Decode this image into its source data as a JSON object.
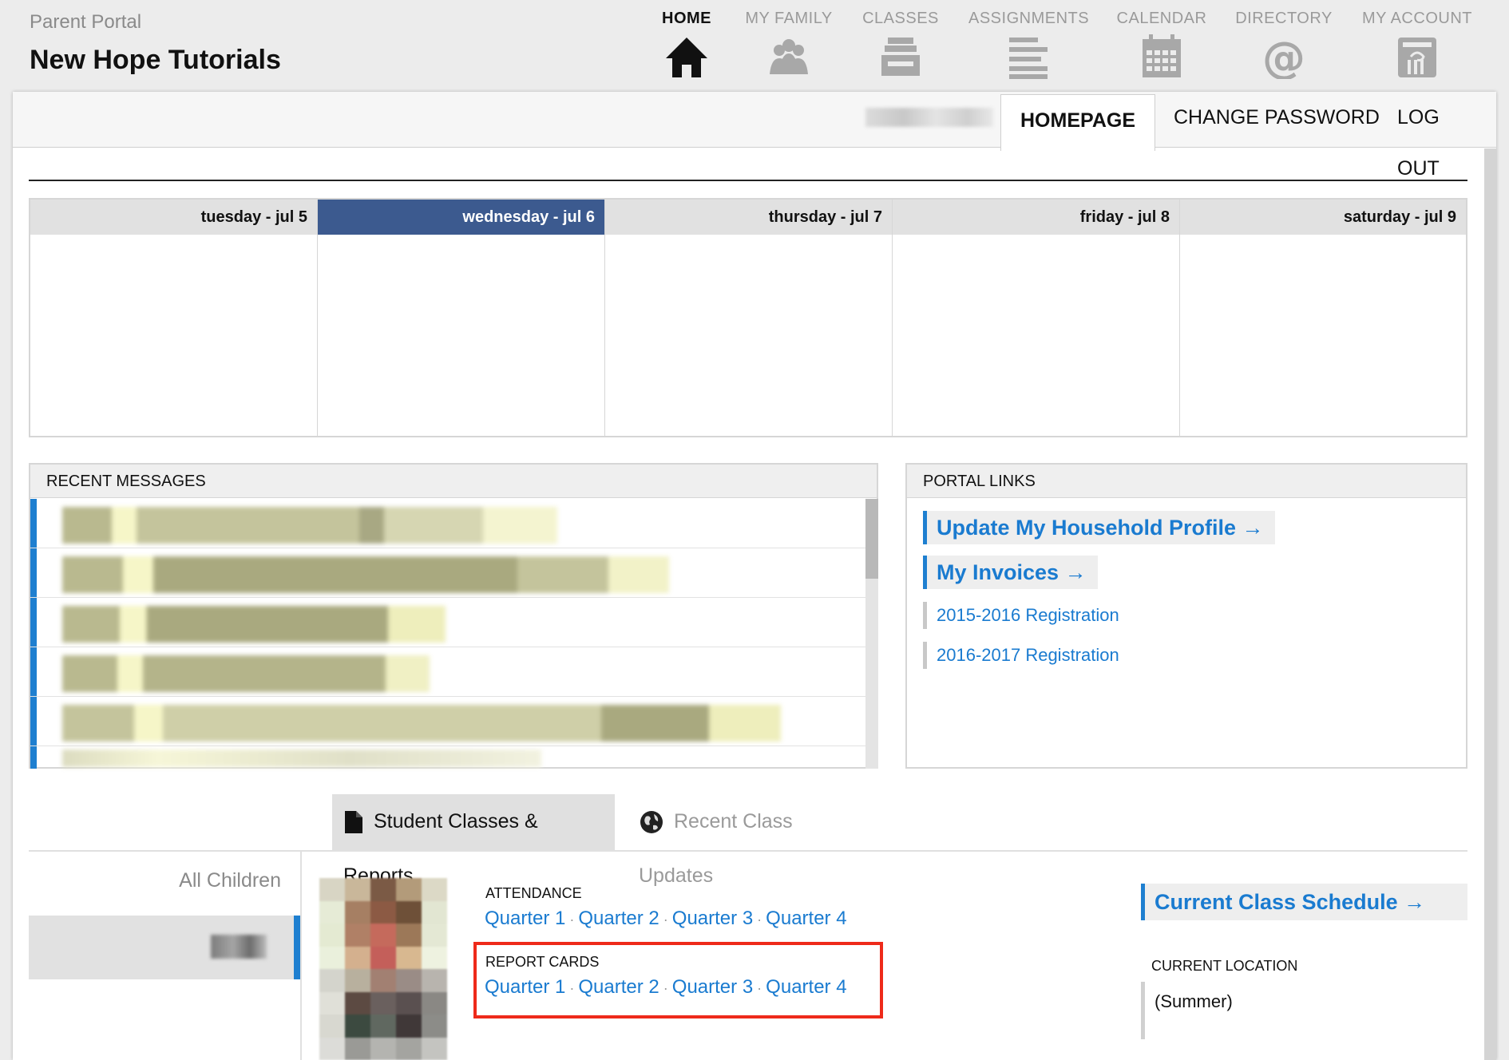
{
  "header": {
    "portal_label": "Parent Portal",
    "school_name": "New Hope Tutorials",
    "nav": [
      {
        "label": "HOME",
        "icon": "home-icon",
        "active": true
      },
      {
        "label": "MY FAMILY",
        "icon": "family-icon"
      },
      {
        "label": "CLASSES",
        "icon": "classes-tray-icon"
      },
      {
        "label": "ASSIGNMENTS",
        "icon": "assignments-lines-icon"
      },
      {
        "label": "CALENDAR",
        "icon": "calendar-icon"
      },
      {
        "label": "DIRECTORY",
        "icon": "at-sign-icon"
      },
      {
        "label": "MY ACCOUNT",
        "icon": "account-column-icon"
      }
    ]
  },
  "subnav": {
    "tabs": [
      {
        "label": "HOMEPAGE",
        "active": true
      },
      {
        "label": "CHANGE PASSWORD"
      },
      {
        "label": "LOG OUT"
      }
    ]
  },
  "calendar": {
    "days": [
      {
        "label": "tuesday - jul 5"
      },
      {
        "label": "wednesday - jul 6",
        "today": true
      },
      {
        "label": "thursday - jul 7"
      },
      {
        "label": "friday - jul 8"
      },
      {
        "label": "saturday - jul 9"
      }
    ],
    "today_color": "#3c5a8f"
  },
  "messages": {
    "title": "RECENT MESSAGES"
  },
  "portal_links": {
    "title": "PORTAL LINKS",
    "links": [
      {
        "label": "Update My Household Profile →"
      },
      {
        "label": "My Invoices →"
      },
      {
        "label": "2015-2016 Registration"
      },
      {
        "label": "2016-2017 Registration"
      }
    ]
  },
  "bottom_tabs": {
    "students": {
      "label": "Student Classes & Reports",
      "icon": "document-icon"
    },
    "updates": {
      "label": "Recent Class Updates",
      "icon": "globe-icon"
    }
  },
  "children": {
    "all_label": "All Children"
  },
  "reports": {
    "attendance_label": "ATTENDANCE",
    "attendance_quarters": [
      "Quarter 1",
      "Quarter 2",
      "Quarter 3",
      "Quarter 4"
    ],
    "report_cards_label": "REPORT CARDS",
    "report_quarters": [
      "Quarter 1",
      "Quarter 2",
      "Quarter 3",
      "Quarter 4"
    ],
    "separator": "·"
  },
  "schedule": {
    "link_label": "Current Class Schedule →",
    "location_label": "CURRENT LOCATION",
    "location_value": "(Summer)"
  },
  "colors": {
    "link": "#1a7bd0",
    "accent_bar": "#1e7fd0",
    "highlight_box": "#ee2a1a"
  }
}
